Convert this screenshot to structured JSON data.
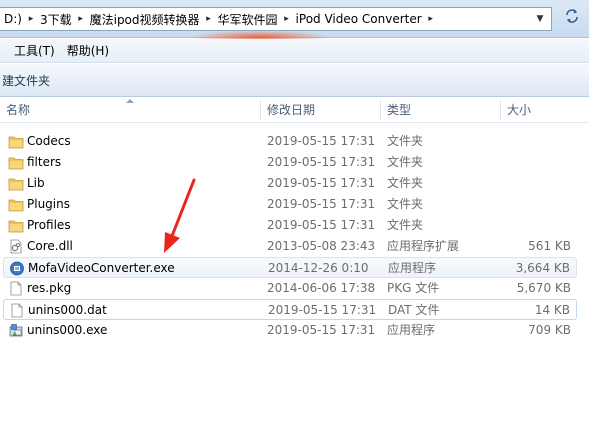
{
  "address": {
    "crumbs": [
      "D:)",
      "3下载",
      "魔法ipod视频转换器",
      "华军软件园",
      "iPod Video Converter"
    ]
  },
  "menu": {
    "items": [
      "工具(T)",
      "帮助(H)"
    ]
  },
  "toolbar": {
    "new_folder": "建文件夹"
  },
  "columns": {
    "name": "名称",
    "date": "修改日期",
    "type": "类型",
    "size": "大小"
  },
  "files": [
    {
      "name": "Codecs",
      "date": "2019-05-15 17:31",
      "type": "文件夹",
      "size": "",
      "icon": "folder-icon"
    },
    {
      "name": "filters",
      "date": "2019-05-15 17:31",
      "type": "文件夹",
      "size": "",
      "icon": "folder-icon"
    },
    {
      "name": "Lib",
      "date": "2019-05-15 17:31",
      "type": "文件夹",
      "size": "",
      "icon": "folder-icon"
    },
    {
      "name": "Plugins",
      "date": "2019-05-15 17:31",
      "type": "文件夹",
      "size": "",
      "icon": "folder-icon"
    },
    {
      "name": "Profiles",
      "date": "2019-05-15 17:31",
      "type": "文件夹",
      "size": "",
      "icon": "folder-icon"
    },
    {
      "name": "Core.dll",
      "date": "2013-05-08 23:43",
      "type": "应用程序扩展",
      "size": "561 KB",
      "icon": "dll-icon"
    },
    {
      "name": "MofaVideoConverter.exe",
      "date": "2014-12-26 0:10",
      "type": "应用程序",
      "size": "3,664 KB",
      "icon": "app-icon"
    },
    {
      "name": "res.pkg",
      "date": "2014-06-06 17:38",
      "type": "PKG 文件",
      "size": "5,670 KB",
      "icon": "file-icon"
    },
    {
      "name": "unins000.dat",
      "date": "2019-05-15 17:31",
      "type": "DAT 文件",
      "size": "14 KB",
      "icon": "file-icon"
    },
    {
      "name": "unins000.exe",
      "date": "2019-05-15 17:31",
      "type": "应用程序",
      "size": "709 KB",
      "icon": "installer-icon"
    }
  ],
  "colors": {
    "folder": "#f1c25a",
    "accent": "#3a78c2",
    "arrow": "#e8271c"
  }
}
